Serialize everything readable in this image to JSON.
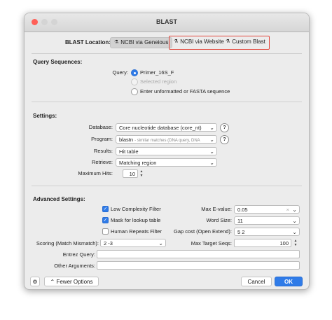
{
  "window": {
    "title": "BLAST"
  },
  "blast_location": {
    "label": "BLAST Location:",
    "options": [
      {
        "label": "NCBI via Geneious",
        "selected": true
      },
      {
        "label": "NCBI via Website",
        "selected": false
      },
      {
        "label": "Custom Blast",
        "selected": false
      }
    ]
  },
  "query": {
    "section_label": "Query Sequences:",
    "query_label": "Query:",
    "options": [
      {
        "label": "Primer_16S_F",
        "selected": true,
        "enabled": true
      },
      {
        "label": "Selected region",
        "selected": false,
        "enabled": false
      },
      {
        "label": "Enter unformatted or FASTA sequence",
        "selected": false,
        "enabled": true
      }
    ]
  },
  "settings": {
    "section_label": "Settings:",
    "database_label": "Database:",
    "database_value": "Core nucleotide database (core_nt)",
    "program_label": "Program:",
    "program_value": "blastn",
    "program_hint": "- similar matches (DNA query, DNA",
    "results_label": "Results:",
    "results_value": "Hit table",
    "retrieve_label": "Retrieve:",
    "retrieve_value": "Matching region",
    "max_hits_label": "Maximum Hits:",
    "max_hits_value": "10",
    "help_glyph": "?"
  },
  "advanced": {
    "section_label": "Advanced Settings:",
    "low_complexity_label": "Low Complexity Filter",
    "low_complexity_checked": true,
    "mask_lookup_label": "Mask for lookup table",
    "mask_lookup_checked": true,
    "human_repeats_label": "Human Repeats Filter",
    "human_repeats_checked": false,
    "max_evalue_label": "Max E-value:",
    "max_evalue_value": "0.05",
    "word_size_label": "Word Size:",
    "word_size_value": "11",
    "gap_cost_label": "Gap cost (Open Extend):",
    "gap_cost_value": "5 2",
    "scoring_label": "Scoring (Match Mismatch):",
    "scoring_value": "2 -3",
    "max_target_label": "Max Target Seqs:",
    "max_target_value": "100",
    "entrez_label": "Entrez Query:",
    "entrez_value": "",
    "other_args_label": "Other Arguments:",
    "other_args_value": ""
  },
  "footer": {
    "fewer_options_label": "Fewer Options",
    "cancel_label": "Cancel",
    "ok_label": "OK"
  },
  "colors": {
    "accent": "#2f7be8",
    "highlight_border": "#e2453a",
    "close": "#ff5f57"
  }
}
